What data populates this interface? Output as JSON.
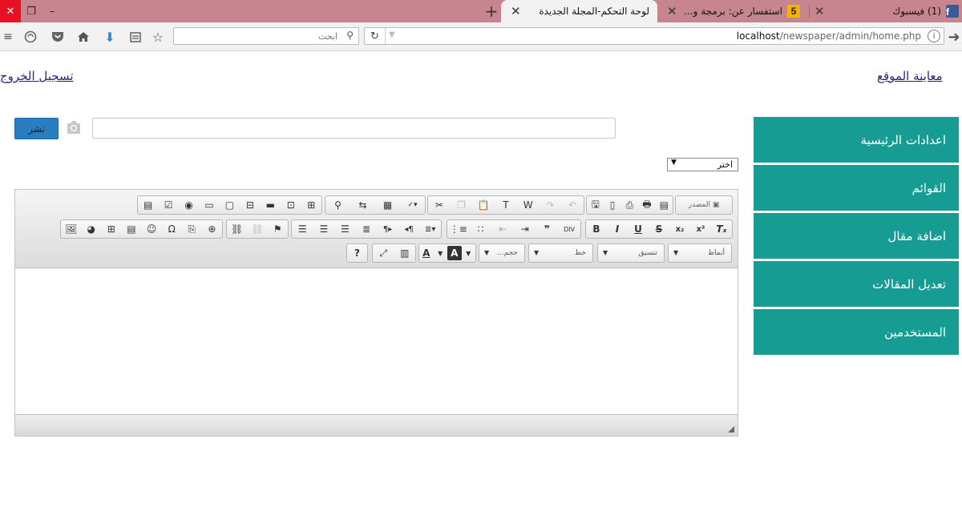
{
  "browser": {
    "tabs": [
      {
        "title": "(1) فيسبوك",
        "icon": "facebook-icon"
      },
      {
        "title": "استفسار عن: برمجة و...",
        "icon": "forum-icon",
        "badge": "5"
      },
      {
        "title": "لوحة التحكم-المجلة الجديدة",
        "active": true
      }
    ],
    "url_host": "localhost",
    "url_path": "/newspaper/admin/home.php",
    "search_placeholder": "ابحث"
  },
  "page": {
    "preview_link": "معاينة الموقع",
    "logout_link": "تسجيل الخروج",
    "publish_label": "نشر",
    "category_select": "اختر",
    "sidebar": [
      {
        "label": "اعدادات الرئيسية"
      },
      {
        "label": "القوائم"
      },
      {
        "label": "اضافة مقال"
      },
      {
        "label": "تعديل المقالات"
      },
      {
        "label": "المستخدمين"
      }
    ]
  },
  "editor": {
    "source_label": "المصدر",
    "styles_label": "أنماط",
    "format_label": "تنسيق",
    "font_label": "خط",
    "size_label": "حجم..."
  },
  "colors": {
    "tab_bar": "#c7858f",
    "sidebar": "#179c94",
    "publish_button": "#2a7dbf"
  }
}
